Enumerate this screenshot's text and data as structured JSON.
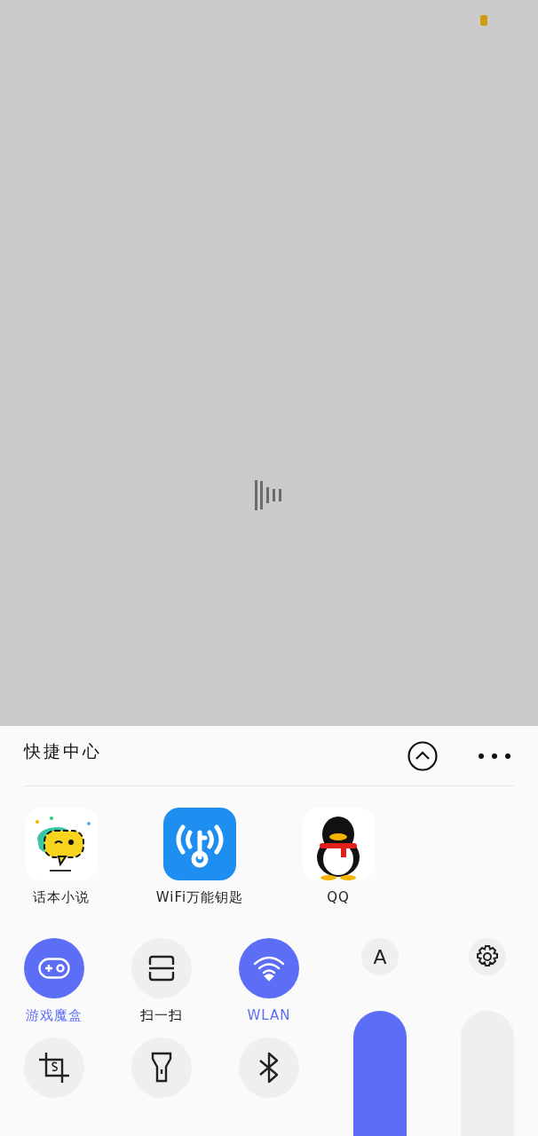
{
  "panel": {
    "title": "快捷中心"
  },
  "apps": [
    {
      "kind": "chat",
      "label": "话本小说"
    },
    {
      "kind": "wifikey",
      "label": "WiFi万能钥匙"
    },
    {
      "kind": "penguin",
      "label": "QQ"
    }
  ],
  "toggles": [
    {
      "kind": "gamepad",
      "label": "游戏魔盒",
      "on": true
    },
    {
      "kind": "scan",
      "label": "扫一扫",
      "on": false
    },
    {
      "kind": "wifi",
      "label": "WLAN",
      "on": true
    },
    {
      "kind": "crop",
      "on": false
    },
    {
      "kind": "flashlight",
      "on": false
    },
    {
      "kind": "bluetooth",
      "on": false
    }
  ],
  "sliders": [
    {
      "kind": "brightness",
      "button": "A",
      "on": true
    },
    {
      "kind": "settings",
      "on": false
    }
  ]
}
